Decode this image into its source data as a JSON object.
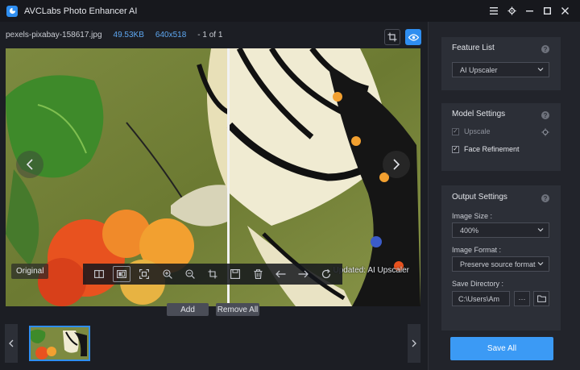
{
  "app": {
    "title": "AVCLabs Photo Enhancer AI"
  },
  "file": {
    "name": "pexels-pixabay-158617.jpg",
    "size": "49.53KB",
    "dimensions": "640x518",
    "count": "- 1 of 1"
  },
  "viewer": {
    "original_label": "Original",
    "updated_label": "Updated: AI Upscaler"
  },
  "strip": {
    "add_label": "Add",
    "remove_all_label": "Remove All"
  },
  "feature_list": {
    "title": "Feature List",
    "selected": "AI Upscaler"
  },
  "model_settings": {
    "title": "Model Settings",
    "upscale_label": "Upscale",
    "face_refinement_label": "Face Refinement"
  },
  "output_settings": {
    "title": "Output Settings",
    "image_size_label": "Image Size :",
    "image_size_value": "400%",
    "image_format_label": "Image Format :",
    "image_format_value": "Preserve source format",
    "save_directory_label": "Save Directory :",
    "save_directory_value": "C:\\Users\\Am",
    "browse_label": "···"
  },
  "save_all_label": "Save All",
  "colors": {
    "accent": "#2f8ef0",
    "background": "#1c1e24",
    "panel": "#2c2f37"
  },
  "icons": [
    "app-logo-icon",
    "menu-icon",
    "settings-icon",
    "minimize-icon",
    "maximize-icon",
    "close-icon",
    "crop-icon",
    "eye-icon",
    "chevron-left-icon",
    "chevron-right-icon",
    "split-view-icon",
    "compare-view-icon",
    "fit-screen-icon",
    "zoom-in-icon",
    "zoom-out-icon",
    "crop-tool-icon",
    "save-icon",
    "delete-icon",
    "arrow-left-icon",
    "arrow-right-icon",
    "refresh-icon",
    "help-icon",
    "gear-icon",
    "folder-icon",
    "chevron-down-icon"
  ]
}
